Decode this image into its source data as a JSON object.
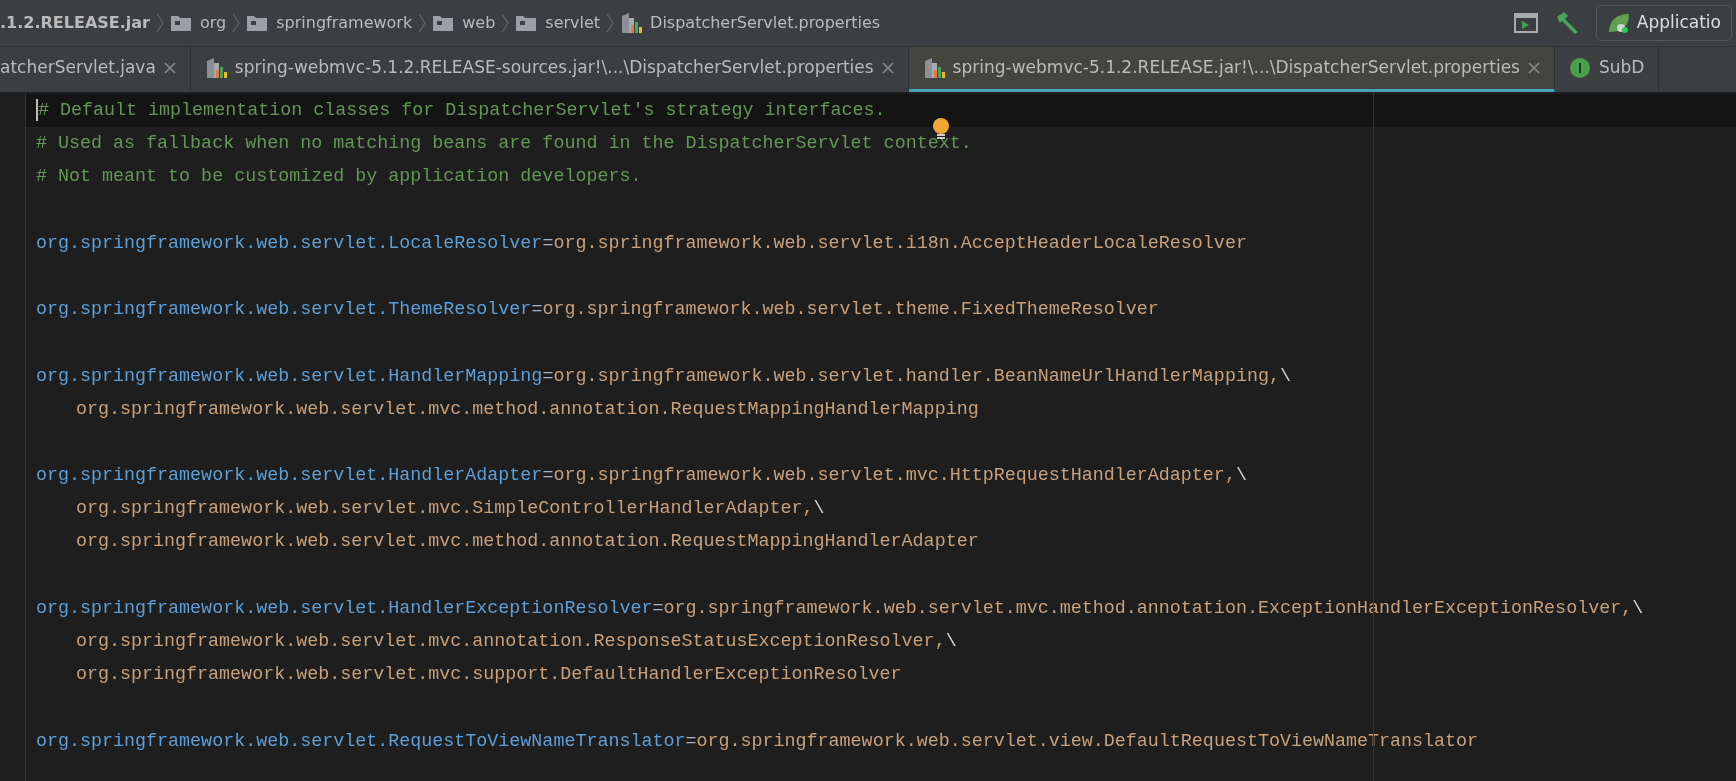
{
  "breadcrumbs": [
    {
      "label": ".1.2.RELEASE.jar",
      "kind": "jar"
    },
    {
      "label": "org",
      "kind": "folder"
    },
    {
      "label": "springframework",
      "kind": "folder"
    },
    {
      "label": "web",
      "kind": "folder"
    },
    {
      "label": "servlet",
      "kind": "folder"
    },
    {
      "label": "DispatcherServlet.properties",
      "kind": "properties"
    }
  ],
  "run_config": {
    "label": "Applicatio"
  },
  "tabs": [
    {
      "label": "atcherServlet.java",
      "kind": "java",
      "selected": false,
      "closable": true
    },
    {
      "label": "spring-webmvc-5.1.2.RELEASE-sources.jar!\\...\\DispatcherServlet.properties",
      "kind": "properties",
      "selected": false,
      "closable": true
    },
    {
      "label": "spring-webmvc-5.1.2.RELEASE.jar!\\...\\DispatcherServlet.properties",
      "kind": "properties",
      "selected": true,
      "closable": true
    },
    {
      "label": "SubD",
      "kind": "interface",
      "selected": false,
      "closable": false
    }
  ],
  "lines": [
    {
      "kind": "comment",
      "text": "# Default implementation classes for DispatcherServlet's strategy interfaces.",
      "current": true
    },
    {
      "kind": "comment",
      "text": "# Used as fallback when no matching beans are found in the DispatcherServlet context."
    },
    {
      "kind": "comment",
      "text": "# Not meant to be customized by application developers."
    },
    {
      "kind": "blank"
    },
    {
      "kind": "entry",
      "key": "org.springframework.web.servlet.LocaleResolver",
      "sep": "=",
      "value": "org.springframework.web.servlet.i18n.AcceptHeaderLocaleResolver"
    },
    {
      "kind": "blank"
    },
    {
      "kind": "entry",
      "key": "org.springframework.web.servlet.ThemeResolver",
      "sep": "=",
      "value": "org.springframework.web.servlet.theme.FixedThemeResolver"
    },
    {
      "kind": "blank"
    },
    {
      "kind": "entry",
      "key": "org.springframework.web.servlet.HandlerMapping",
      "sep": "=",
      "value": "org.springframework.web.servlet.handler.BeanNameUrlHandlerMapping,",
      "tail": "\\"
    },
    {
      "kind": "value",
      "value": "org.springframework.web.servlet.mvc.method.annotation.RequestMappingHandlerMapping"
    },
    {
      "kind": "blank"
    },
    {
      "kind": "entry",
      "key": "org.springframework.web.servlet.HandlerAdapter",
      "sep": "=",
      "value": "org.springframework.web.servlet.mvc.HttpRequestHandlerAdapter,",
      "tail": "\\"
    },
    {
      "kind": "value",
      "value": "org.springframework.web.servlet.mvc.SimpleControllerHandlerAdapter,",
      "tail": "\\"
    },
    {
      "kind": "value",
      "value": "org.springframework.web.servlet.mvc.method.annotation.RequestMappingHandlerAdapter"
    },
    {
      "kind": "blank"
    },
    {
      "kind": "entry",
      "key": "org.springframework.web.servlet.HandlerExceptionResolver",
      "sep": "=",
      "value": "org.springframework.web.servlet.mvc.method.annotation.ExceptionHandlerExceptionResolver,",
      "tail": "\\"
    },
    {
      "kind": "value",
      "value": "org.springframework.web.servlet.mvc.annotation.ResponseStatusExceptionResolver,",
      "tail": "\\"
    },
    {
      "kind": "value",
      "value": "org.springframework.web.servlet.mvc.support.DefaultHandlerExceptionResolver"
    },
    {
      "kind": "blank"
    },
    {
      "kind": "entry",
      "key": "org.springframework.web.servlet.RequestToViewNameTranslator",
      "sep": "=",
      "value": "org.springframework.web.servlet.view.DefaultRequestToViewNameTranslator"
    }
  ]
}
